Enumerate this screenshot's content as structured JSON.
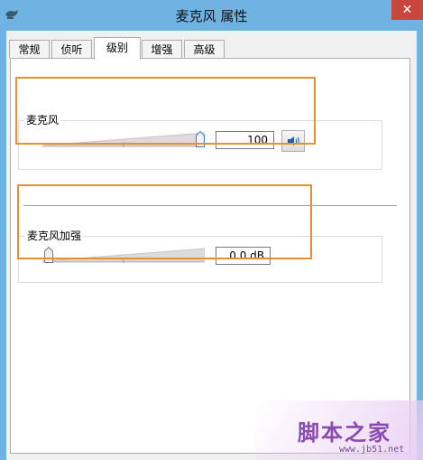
{
  "window": {
    "title": "麦克风 属性",
    "close_glyph": "✕"
  },
  "tabs": [
    {
      "label": "常规",
      "active": false
    },
    {
      "label": "侦听",
      "active": false
    },
    {
      "label": "级别",
      "active": true
    },
    {
      "label": "增强",
      "active": false
    },
    {
      "label": "高级",
      "active": false
    }
  ],
  "microphone": {
    "label": "麦克风",
    "value": "100",
    "level": 1.0,
    "mute_icon": "speaker-icon"
  },
  "boost": {
    "label": "麦克风加强",
    "value": "0.0 dB",
    "level": 0.0
  },
  "watermark": {
    "text": "脚本之家",
    "url": "www.jb51.net"
  },
  "colors": {
    "titlebar": "#6fb3e3",
    "close": "#c9463d",
    "highlight": "#e8902e",
    "watermark": "#8a4bb0"
  }
}
